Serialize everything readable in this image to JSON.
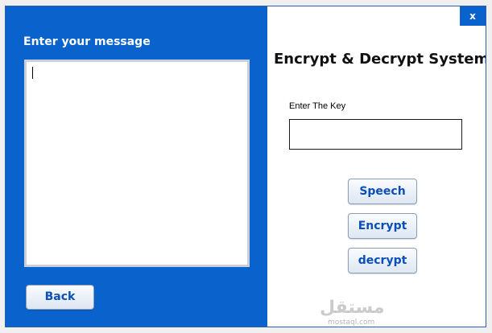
{
  "window": {
    "close_label": "x"
  },
  "left": {
    "title": "Enter your message",
    "message_value": "",
    "back_label": "Back"
  },
  "right": {
    "title": "Encrypt & Decrypt System",
    "key_label": "Enter The Key",
    "key_value": "",
    "buttons": {
      "speech": "Speech",
      "encrypt": "Encrypt",
      "decrypt": "decrypt"
    }
  },
  "watermark": {
    "arabic": "مستقل",
    "latin": "mostaql.com"
  },
  "colors": {
    "panel_blue": "#0a62cc",
    "button_text": "#0a4fb8"
  }
}
